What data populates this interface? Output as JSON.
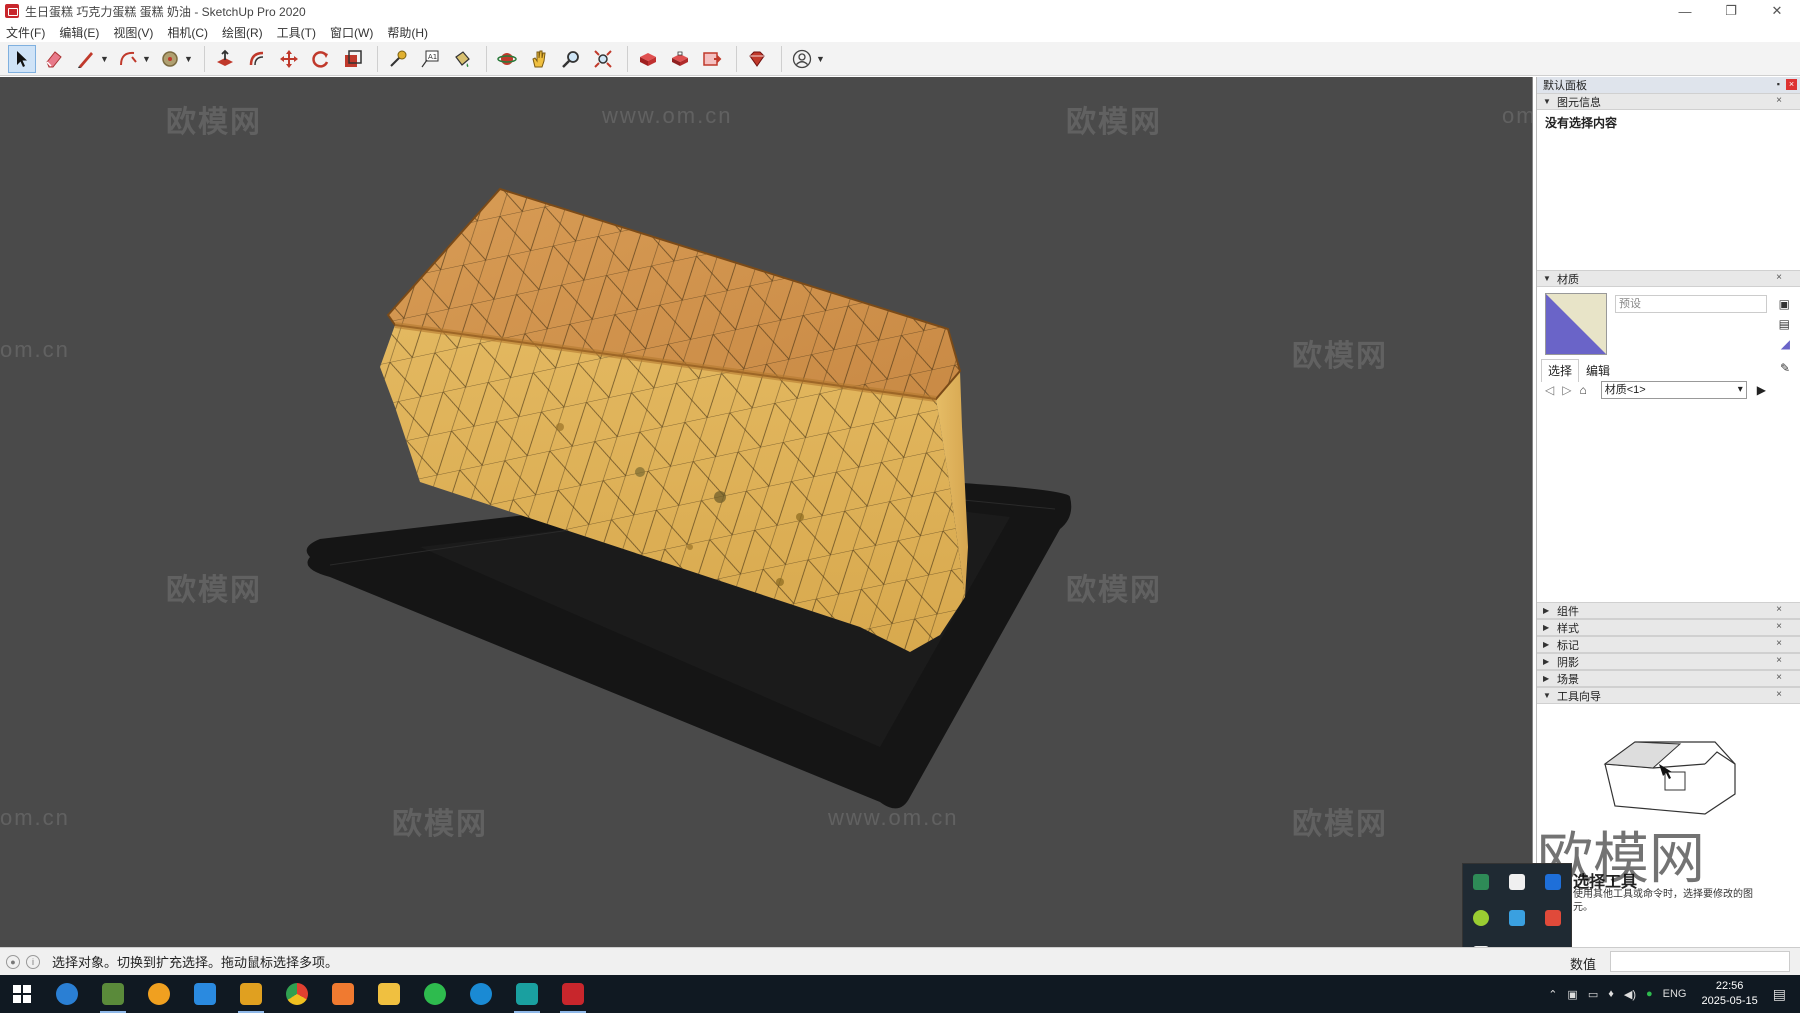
{
  "window": {
    "title": "生日蛋糕 巧克力蛋糕 蛋糕 奶油 - SketchUp Pro 2020",
    "minimize": "—",
    "restore": "❐",
    "close": "✕"
  },
  "menu": [
    "文件(F)",
    "编辑(E)",
    "视图(V)",
    "相机(C)",
    "绘图(R)",
    "工具(T)",
    "窗口(W)",
    "帮助(H)"
  ],
  "watermarks": {
    "brand": "欧模网",
    "site": "www.om.cn",
    "partial": "om.cn"
  },
  "panel": {
    "tray_title": "默认面板",
    "entity_info": {
      "title": "图元信息",
      "empty_text": "没有选择内容"
    },
    "materials": {
      "title": "材质",
      "name_placeholder": "预设",
      "tab_select": "选择",
      "tab_edit": "编辑",
      "library": "材质<1>",
      "swatch_color": "#6a64c8"
    },
    "collapsed_sections": [
      "组件",
      "样式",
      "标记",
      "阴影",
      "场景"
    ],
    "instructor": {
      "title": "工具向导",
      "tool_name": "选择工具",
      "desc": "使用其他工具或命令时，选择要修改的图元。"
    }
  },
  "status": {
    "hint": "选择对象。切换到扩充选择。拖动鼠标选择多项。",
    "measurements_label": "数值"
  },
  "taskbar": {
    "tray_language": "ENG",
    "time": "22:56",
    "date": "2025-05-15"
  },
  "icons": {
    "select": "select-arrow-icon",
    "eraser": "eraser-icon",
    "pencil": "line-pencil-icon",
    "arc": "arc-icon",
    "circle": "shape-icon",
    "pushpull": "push-pull-icon",
    "offset": "offset-icon",
    "move": "move-icon",
    "rotate": "rotate-icon",
    "scale": "scale-icon",
    "tape": "tape-measure-icon",
    "text": "text-icon",
    "paint": "paint-bucket-icon",
    "orbit": "orbit-icon",
    "pan": "pan-icon",
    "zoom": "zoom-icon",
    "zoom_extents": "zoom-extents-icon",
    "warehouse": "3d-warehouse-icon",
    "extension": "extension-warehouse-icon",
    "layout": "send-to-layout-icon",
    "ruby": "extension-manager-icon",
    "account": "account-icon"
  }
}
